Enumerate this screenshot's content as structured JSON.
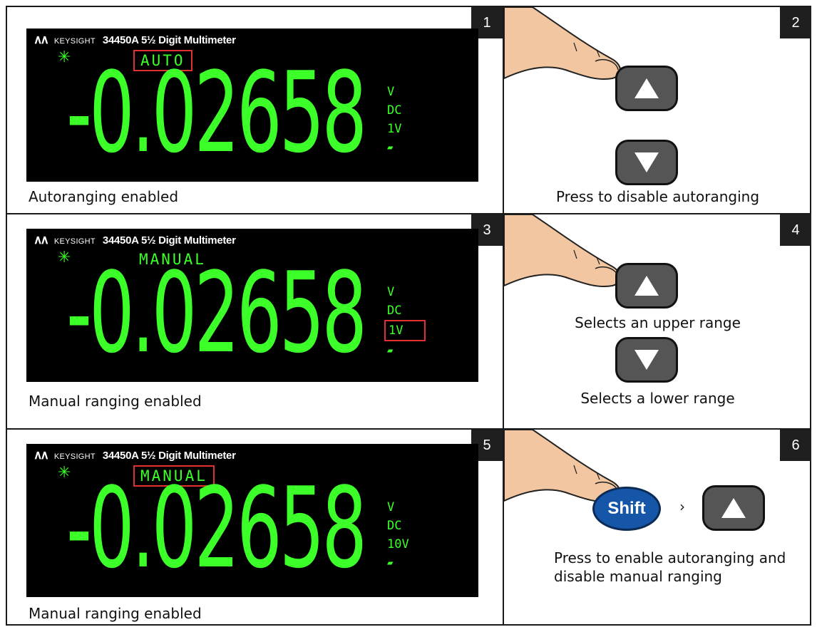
{
  "panels": [
    {
      "number": "1",
      "brand": "KEYSIGHT",
      "model": "34450A  5½ Digit Multimeter",
      "mode": "AUTO",
      "reading": "-0.02658",
      "unit": "V",
      "coupling": "DC",
      "range": "1V",
      "caption": "Autoranging enabled"
    },
    {
      "number": "2",
      "caption": "Press to disable autoranging"
    },
    {
      "number": "3",
      "brand": "KEYSIGHT",
      "model": "34450A  5½ Digit Multimeter",
      "mode": "MANUAL",
      "reading": "-0.02658",
      "unit": "V",
      "coupling": "DC",
      "range": "1V",
      "caption": "Manual ranging enabled"
    },
    {
      "number": "4",
      "up_label": "Selects an upper range",
      "down_label": "Selects a lower range"
    },
    {
      "number": "5",
      "brand": "KEYSIGHT",
      "model": "34450A  5½ Digit Multimeter",
      "mode": "MANUAL",
      "reading": "-0.02658",
      "unit": "V",
      "coupling": "DC",
      "range": "10V",
      "caption": "Manual ranging enabled"
    },
    {
      "number": "6",
      "shift_label": "Shift",
      "separator": "›",
      "caption_line1": "Press to enable autoranging and",
      "caption_line2": "disable manual ranging"
    }
  ],
  "colors": {
    "display_green": "#3cff2a",
    "highlight_red": "#e03030",
    "shift_blue": "#1656a8"
  },
  "icons": [
    "keysight-logo-icon",
    "sun-icon",
    "up-arrow-icon",
    "down-arrow-icon",
    "finger-icon"
  ]
}
